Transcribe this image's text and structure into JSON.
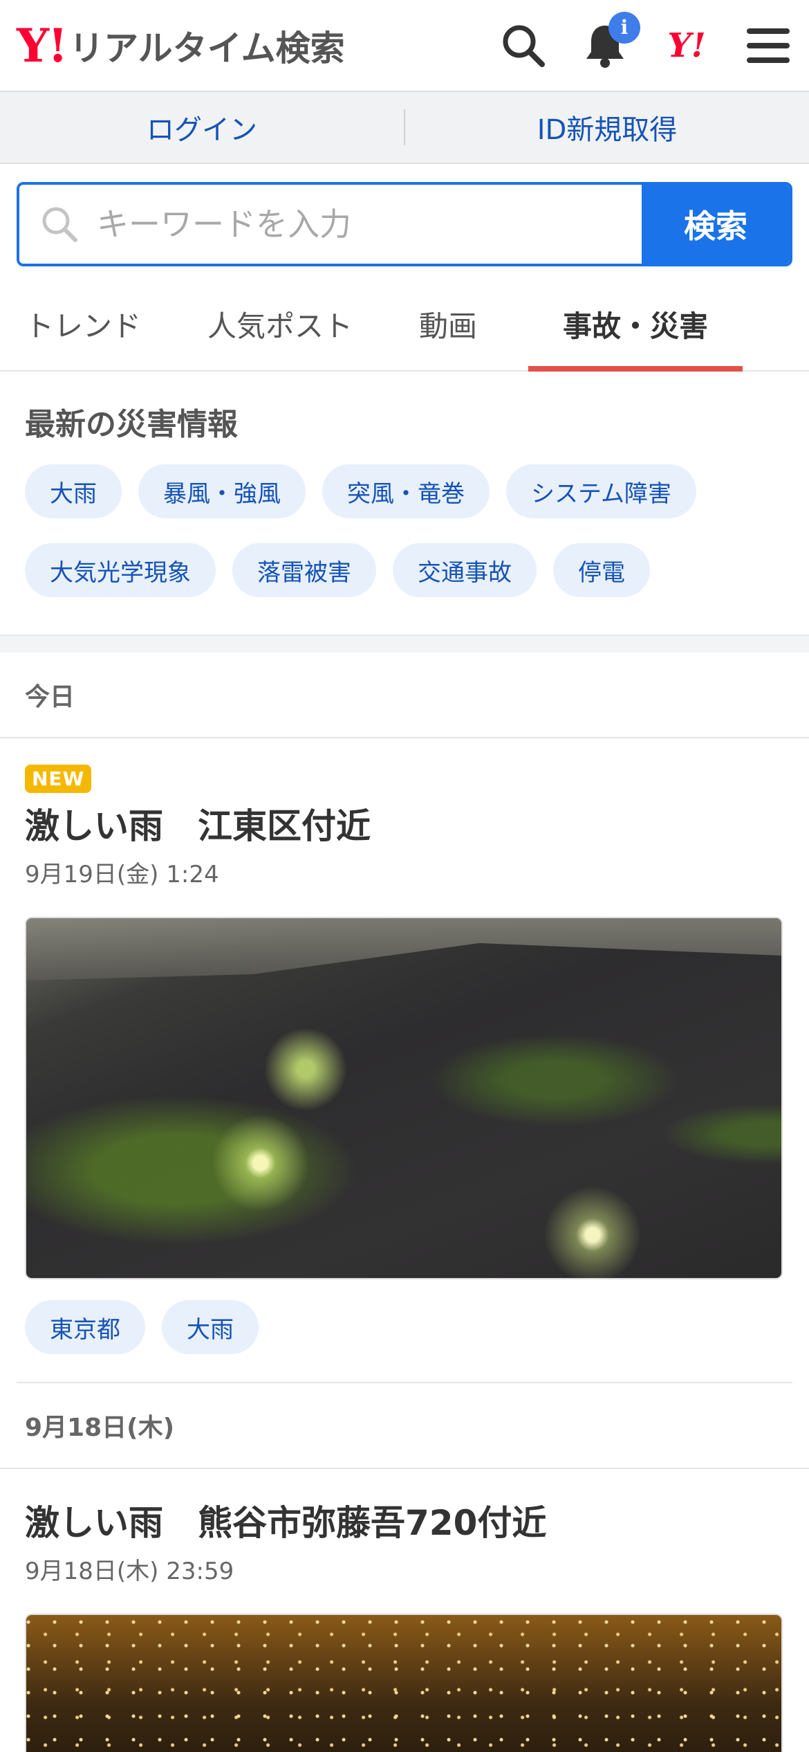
{
  "header": {
    "logo_y": "Y!",
    "logo_text": "リアルタイム検索",
    "notice_badge": "i",
    "yj_mark": "Y!",
    "icons": [
      "search-icon",
      "bell-icon",
      "yahoo-japan-icon",
      "hamburger-menu-icon"
    ]
  },
  "loginbar": {
    "login": "ログイン",
    "register": "ID新規取得"
  },
  "search": {
    "placeholder": "キーワードを入力",
    "button": "検索"
  },
  "tabs": [
    {
      "label": "トレンド",
      "active": false
    },
    {
      "label": "人気ポスト",
      "active": false
    },
    {
      "label": "動画",
      "active": false
    },
    {
      "label": "事故・災害",
      "active": true
    }
  ],
  "disaster": {
    "title": "最新の災害情報",
    "chips": [
      "大雨",
      "暴風・強風",
      "突風・竜巻",
      "システム障害",
      "大気光学現象",
      "落雷被害",
      "交通事故",
      "停電"
    ]
  },
  "days": [
    {
      "header": "今日",
      "posts": [
        {
          "badge": "NEW",
          "title": "激しい雨　江東区付近",
          "date": "9月19日(金) 1:24",
          "tags": [
            "東京都",
            "大雨"
          ]
        }
      ]
    },
    {
      "header": "9月18日(木)",
      "posts": [
        {
          "title": "激しい雨　熊谷市弥藤吾720付近",
          "date": "9月18日(木) 23:59"
        }
      ]
    }
  ],
  "colors": {
    "accent": "#1a73e8",
    "tab_underline": "#e0524a",
    "chip_bg": "#e8f0fc",
    "new_badge": "#f5b800",
    "brand": "#ff0033"
  }
}
